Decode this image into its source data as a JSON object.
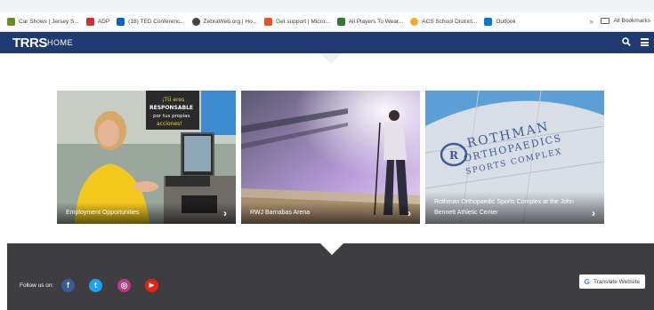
{
  "bookmarks": [
    {
      "label": "Car Shows | Jersey S...",
      "color": "#6b8e23"
    },
    {
      "label": "ADP",
      "color": "#d32f2f"
    },
    {
      "label": "(18) TED Conferenc...",
      "color": "#0a66c2"
    },
    {
      "label": "ZebraWeb.org | Ho...",
      "color": "#444444"
    },
    {
      "label": "Get support | Micro...",
      "color": "#f25022"
    },
    {
      "label": "All Players To Wear...",
      "color": "#2e7d32"
    },
    {
      "label": "ACS School District...",
      "color": "#f9a825"
    },
    {
      "label": "Outlook",
      "color": "#0078d4"
    }
  ],
  "bookmarks_more": "»",
  "all_bookmarks": "All Bookmarks",
  "navbar": {
    "logo": "TRRS",
    "home": "HOME",
    "bg_color": "#1f3a6e"
  },
  "cards": [
    {
      "caption": "Employment Opportunities",
      "chevron": "›"
    },
    {
      "caption": "RWJ Barnabas Arena",
      "chevron": "›"
    },
    {
      "caption": "Rothman Orthopaedic Sports Complex at the John Bennett Athletic Center",
      "chevron": "›"
    }
  ],
  "card3_sign": {
    "line1": "ROTHMAN",
    "line2": "ORTHOPAEDICS",
    "line3": "SPORTS COMPLEX"
  },
  "card1_poster": {
    "line1": "¡TÚ eres",
    "line2": "RESPONSABLE",
    "line3": "por tus propias",
    "line4": "acciones!"
  },
  "footer": {
    "follow_label": "Follow us on:",
    "social": [
      {
        "icon": "facebook-icon",
        "glyph": "f",
        "color": "#3b5998"
      },
      {
        "icon": "twitter-icon",
        "glyph": "t",
        "color": "#1da1f2"
      },
      {
        "icon": "instagram-icon",
        "glyph": "◎",
        "color": "#c13584"
      },
      {
        "icon": "youtube-icon",
        "glyph": "▶",
        "color": "#e62117"
      }
    ],
    "translate_label": "Translate Website",
    "bg_color": "#3e3e40"
  }
}
